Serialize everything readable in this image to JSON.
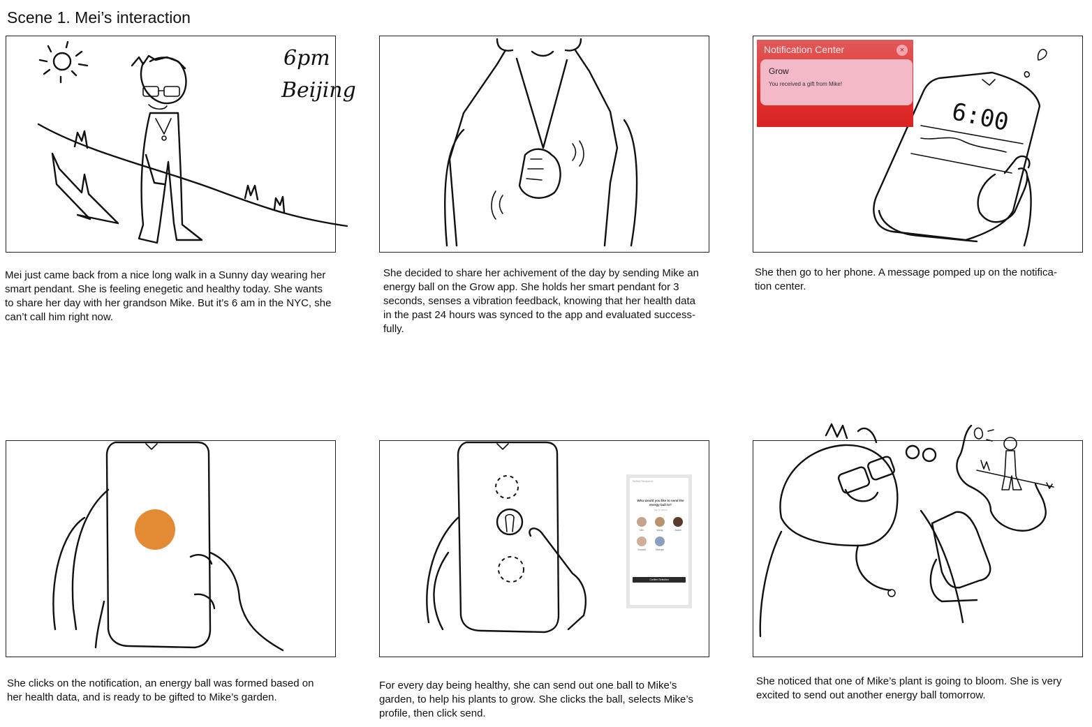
{
  "title": "Scene 1. Mei’s interaction",
  "panels": [
    {
      "caption": [
        "Mei just came back from a nice long walk in a Sunny day wearing her",
        "smart pendant. She is feeling enegetic and healthy today. She wants",
        "to  share her day with her grandson Mike. But it’s 6 am in the NYC, she",
        "can’t call him right now."
      ],
      "handwriting": [
        "6pm",
        "Beijing"
      ]
    },
    {
      "caption": [
        "She decided to share her achivement of the day by sending Mike an",
        "energy ball on the Grow app. She holds her smart pendant for 3",
        "seconds, senses a vibration feedback, knowing that her health data",
        "in the past 24 hours was synced to the app and evaluated success-",
        "fully."
      ]
    },
    {
      "caption": [
        "She then go to her phone. A message pomped up on the notifica-",
        "tion center."
      ],
      "notification": {
        "header": "Notification Center",
        "close": "×",
        "app": "Grow",
        "message": "You received a gift from Mike!"
      },
      "phone_time": "6:00"
    },
    {
      "caption": [
        "She clicks on the notification, an energy ball was formed  based on",
        "her health data, and is ready to be gifted to Mike’s garden."
      ],
      "ball_color": "#e38a34"
    },
    {
      "caption": [
        "For every day being healthy, she can send out one ball to Mike’s",
        "garden, to help his plants to grow. She clicks the ball, selects Mike’s",
        "profile, then click send."
      ],
      "recipient_screen": {
        "top_label": "Select Recipient",
        "question": "Who would you like to send the energy ball to?",
        "subtitle": "Tap to select",
        "contacts": [
          {
            "name": "Mei",
            "color": "#c7a58c"
          },
          {
            "name": "Wang",
            "color": "#b9926f"
          },
          {
            "name": "Jackie",
            "color": "#5a3a2a"
          },
          {
            "name": "Donald",
            "color": "#d1b09a"
          },
          {
            "name": "Michael",
            "color": "#8aa0c0"
          }
        ],
        "button": "Confirm Selection"
      }
    },
    {
      "caption": [
        "She noticed that one of Mike’s plant is going to bloom. She is very",
        "excited to send out another energy ball tomorrow."
      ]
    }
  ]
}
